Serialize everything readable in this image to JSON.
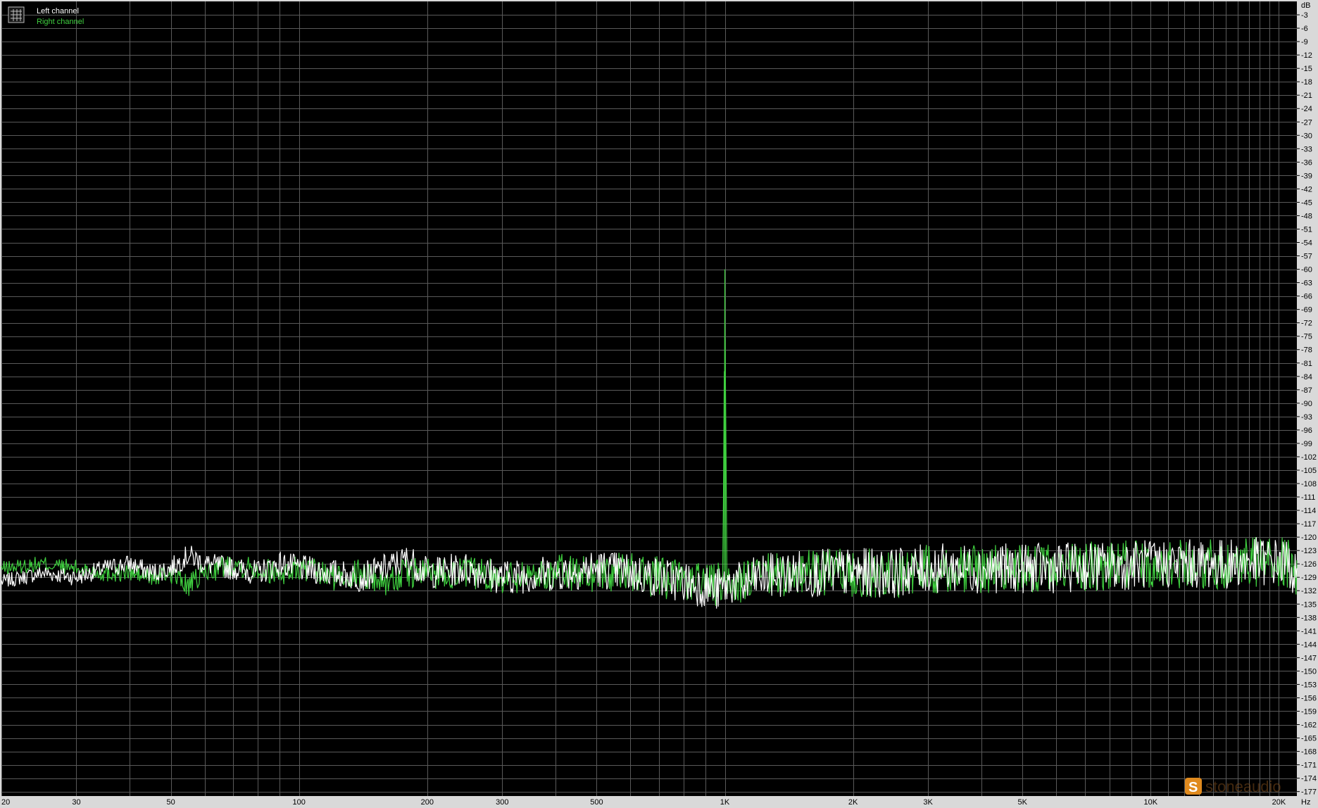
{
  "chart_data": {
    "type": "line",
    "title": "",
    "xlabel": "Hz",
    "ylabel": "dB",
    "x_scale": "log",
    "xlim": [
      20,
      22050
    ],
    "ylim": [
      -178,
      0
    ],
    "grid": true,
    "legend_placement": "top-left",
    "background_color": "#000000",
    "grid_color": "#5a5a5a",
    "x_tick_labels": [
      {
        "value": 20,
        "label": "20"
      },
      {
        "value": 30,
        "label": "30"
      },
      {
        "value": 50,
        "label": "50"
      },
      {
        "value": 100,
        "label": "100"
      },
      {
        "value": 200,
        "label": "200"
      },
      {
        "value": 300,
        "label": "300"
      },
      {
        "value": 500,
        "label": "500"
      },
      {
        "value": 1000,
        "label": "1K"
      },
      {
        "value": 2000,
        "label": "2K"
      },
      {
        "value": 3000,
        "label": "3K"
      },
      {
        "value": 5000,
        "label": "5K"
      },
      {
        "value": 10000,
        "label": "10K"
      },
      {
        "value": 20000,
        "label": "20K"
      }
    ],
    "x_unit_label": "Hz",
    "y_unit_label": "dB",
    "y_tick_labels": [
      "-3",
      "-6",
      "-9",
      "-12",
      "-15",
      "-18",
      "-21",
      "-24",
      "-27",
      "-30",
      "-33",
      "-36",
      "-39",
      "-42",
      "-45",
      "-48",
      "-51",
      "-54",
      "-57",
      "-60",
      "-63",
      "-66",
      "-69",
      "-72",
      "-75",
      "-78",
      "-81",
      "-84",
      "-87",
      "-90",
      "-93",
      "-96",
      "-99",
      "-102",
      "-105",
      "-108",
      "-111",
      "-114",
      "-117",
      "-120",
      "-123",
      "-126",
      "-129",
      "-132",
      "-135",
      "-138",
      "-141",
      "-144",
      "-147",
      "-150",
      "-153",
      "-156",
      "-159",
      "-162",
      "-165",
      "-168",
      "-171",
      "-174",
      "-177"
    ],
    "series": [
      {
        "name": "Left channel",
        "color": "#ffffff",
        "x": [
          20,
          25,
          30,
          35,
          40,
          45,
          50,
          55,
          60,
          70,
          80,
          90,
          100,
          120,
          140,
          160,
          180,
          200,
          250,
          300,
          400,
          500,
          600,
          700,
          800,
          900,
          950,
          1000,
          1050,
          1100,
          1200,
          1500,
          2000,
          2500,
          3000,
          4000,
          5000,
          6000,
          7000,
          8000,
          10000,
          12000,
          15000,
          18000,
          20000,
          21000,
          22050
        ],
        "y": [
          -130,
          -128,
          -129,
          -127,
          -126,
          -128,
          -127,
          -124,
          -126,
          -127,
          -128,
          -126,
          -127,
          -128,
          -129,
          -127,
          -125,
          -128,
          -127,
          -129,
          -128,
          -127,
          -128,
          -129,
          -130,
          -131,
          -132,
          -131,
          -130,
          -131,
          -129,
          -128,
          -128,
          -128,
          -127,
          -127,
          -127,
          -127,
          -126.5,
          -126.5,
          -126,
          -126,
          -126,
          -125.5,
          -125.5,
          -126,
          -129
        ],
        "noise_amplitude_db": 4
      },
      {
        "name": "Right channel",
        "color": "#3fcf3f",
        "x": [
          20,
          25,
          30,
          35,
          40,
          45,
          50,
          55,
          60,
          70,
          80,
          90,
          100,
          120,
          140,
          160,
          180,
          200,
          250,
          300,
          400,
          500,
          600,
          700,
          800,
          900,
          950,
          990,
          1000,
          1010,
          1050,
          1100,
          1200,
          1500,
          2000,
          2500,
          3000,
          4000,
          5000,
          6000,
          7000,
          8000,
          10000,
          12000,
          15000,
          18000,
          20000,
          21000,
          22050
        ],
        "y": [
          -127,
          -126,
          -127,
          -128,
          -128,
          -129,
          -128,
          -131,
          -128,
          -126,
          -127,
          -128,
          -127,
          -129,
          -128,
          -130,
          -128,
          -128,
          -128,
          -129,
          -128,
          -128,
          -128,
          -129,
          -130,
          -130,
          -131,
          -130,
          -60,
          -130,
          -130,
          -130,
          -129,
          -128,
          -128,
          -128,
          -127,
          -127,
          -127,
          -127,
          -126.5,
          -126.5,
          -126,
          -126,
          -126,
          -125.5,
          -125.5,
          -126,
          -130
        ],
        "noise_amplitude_db": 4
      }
    ]
  },
  "legend": {
    "icon": "spectrum-icon",
    "items": [
      {
        "label": "Left channel",
        "color": "#ffffff"
      },
      {
        "label": "Right channel",
        "color": "#3fcf3f"
      }
    ]
  },
  "watermark": {
    "icon": "stone-logo-icon",
    "text": "stoneaudio",
    "color": "#e08a1e"
  }
}
